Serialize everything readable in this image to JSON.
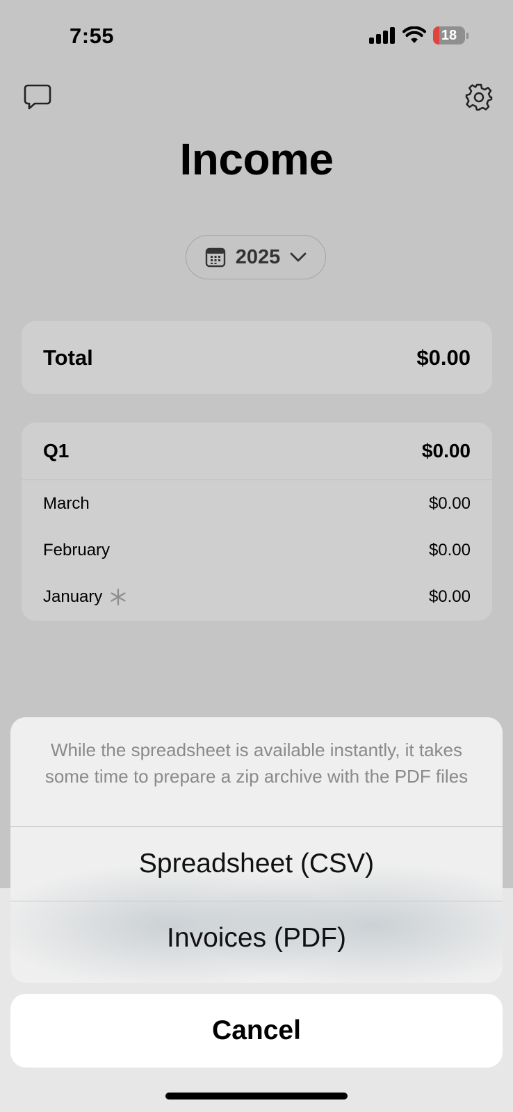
{
  "status_bar": {
    "time": "7:55",
    "battery": "18"
  },
  "header": {
    "title": "Income",
    "chat_icon": "chat-bubble-icon",
    "settings_icon": "gear-icon"
  },
  "year_selector": {
    "year": "2025",
    "icon": "calendar-icon"
  },
  "total": {
    "label": "Total",
    "amount": "$0.00"
  },
  "quarter": {
    "label": "Q1",
    "amount": "$0.00",
    "months": [
      {
        "label": "March",
        "amount": "$0.00"
      },
      {
        "label": "February",
        "amount": "$0.00"
      },
      {
        "label": "January",
        "amount": "$0.00"
      }
    ]
  },
  "action_sheet": {
    "message": "While the spreadsheet is available instantly, it takes some time to prepare a zip archive with the PDF files",
    "options": [
      "Spreadsheet (CSV)",
      "Invoices (PDF)"
    ],
    "cancel": "Cancel"
  }
}
